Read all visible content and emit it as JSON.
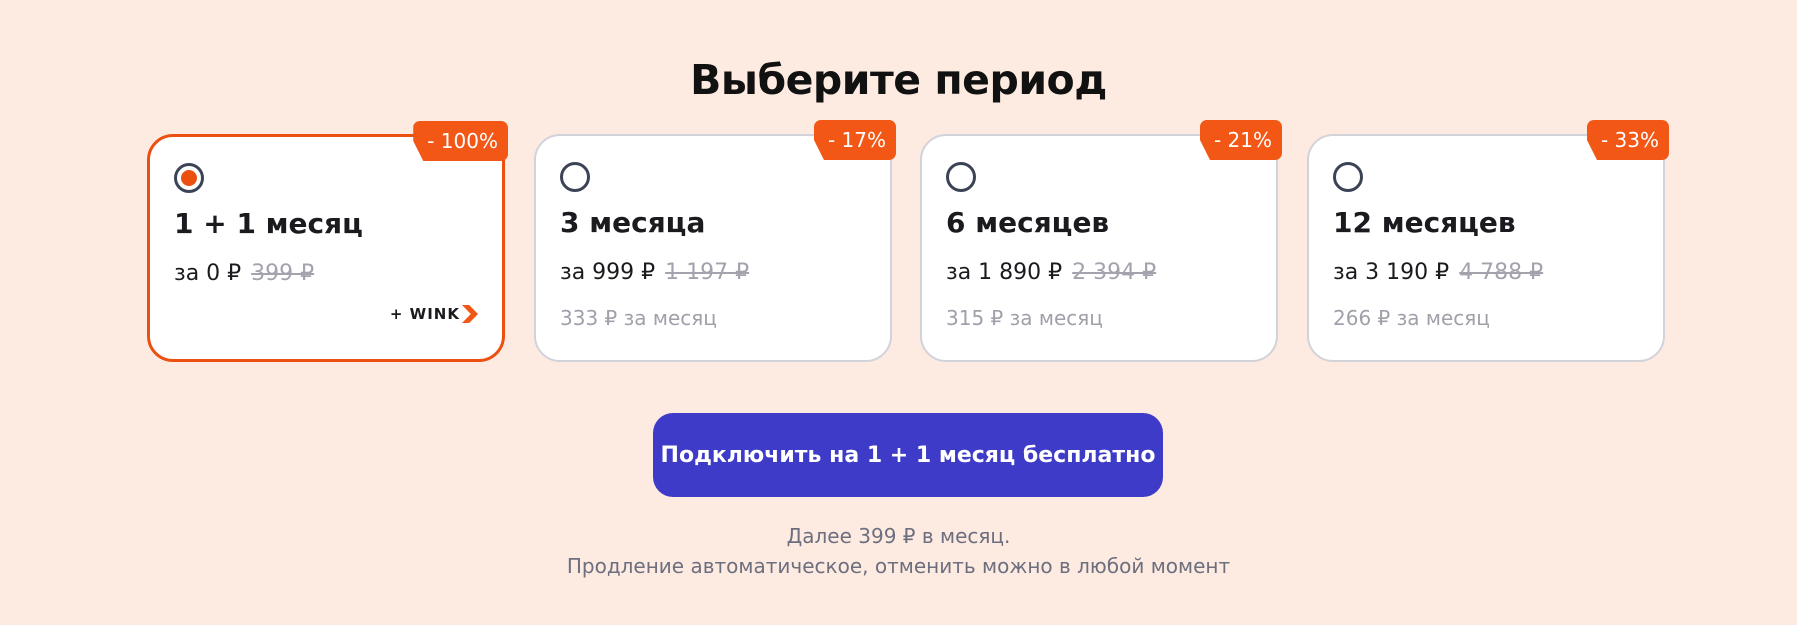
{
  "title": "Выберите период",
  "colors": {
    "background": "#fdebe2",
    "accent": "#f25716",
    "selected_border": "#ec5010",
    "button": "#3d3bc7"
  },
  "plans": [
    {
      "badge": "- 100%",
      "name": "1 + 1 месяц",
      "price": "за 0 ₽",
      "old_price": "399 ₽",
      "extra": "+ WINK",
      "selected": true
    },
    {
      "badge": "- 17%",
      "name": "3 месяца",
      "price": "за 999 ₽",
      "old_price": "1 197 ₽",
      "per_month": "333 ₽ за месяц",
      "selected": false
    },
    {
      "badge": "- 21%",
      "name": "6 месяцев",
      "price": "за 1 890 ₽",
      "old_price": "2 394 ₽",
      "per_month": "315 ₽ за месяц",
      "selected": false
    },
    {
      "badge": "- 33%",
      "name": "12 месяцев",
      "price": "за 3 190 ₽",
      "old_price": "4 788 ₽",
      "per_month": "266 ₽ за месяц",
      "selected": false
    }
  ],
  "cta": {
    "label": "Подключить на 1 + 1 месяц бесплатно"
  },
  "notes": {
    "line1": "Далее 399 ₽ в месяц.",
    "line2": "Продление автоматическое, отменить можно в любой момент"
  }
}
